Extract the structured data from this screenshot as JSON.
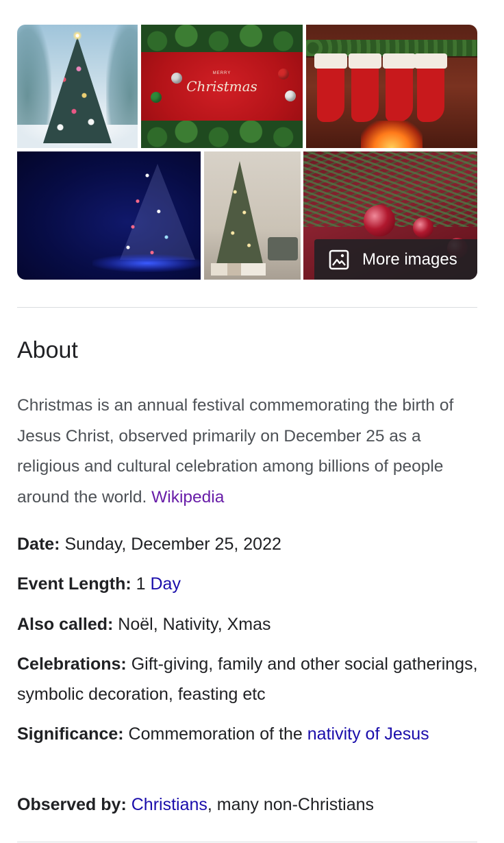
{
  "images": {
    "tiles": [
      {
        "name": "snowy-christmas-tree"
      },
      {
        "name": "merry-christmas-card",
        "caption_small": "MERRY",
        "caption_script": "Christmas"
      },
      {
        "name": "christmas-stockings"
      },
      {
        "name": "blue-light-tree"
      },
      {
        "name": "living-room-tree"
      },
      {
        "name": "red-baubles"
      }
    ],
    "more_images_label": "More images",
    "more_images_icon": "image-icon"
  },
  "about": {
    "title": "About",
    "description": "Christmas is an annual festival commemorating the birth of Jesus Christ, observed primarily on December 25 as a religious and cultural celebration among billions of people around the world.",
    "source_link": "Wikipedia"
  },
  "facts": {
    "date": {
      "label": "Date:",
      "value": "Sunday, December 25, 2022"
    },
    "event_length": {
      "label": "Event Length:",
      "value_prefix": "1",
      "link": "Day"
    },
    "also_called": {
      "label": "Also called:",
      "value": "Noël, Nativity, Xmas"
    },
    "celebrations": {
      "label": "Celebrations:",
      "value": "Gift-giving, family and other social gatherings, symbolic decoration, feasting etc"
    },
    "significance": {
      "label": "Significance:",
      "value_prefix": "Commemoration of the",
      "link": "nativity of Jesus"
    },
    "observed_by": {
      "label": "Observed by:",
      "link": "Christians",
      "value_suffix": ", many non-Christians"
    }
  },
  "colors": {
    "text_primary": "#202124",
    "text_secondary": "#4d5156",
    "link": "#1a0dab",
    "visited_link": "#681da8",
    "divider": "#dadce0"
  }
}
